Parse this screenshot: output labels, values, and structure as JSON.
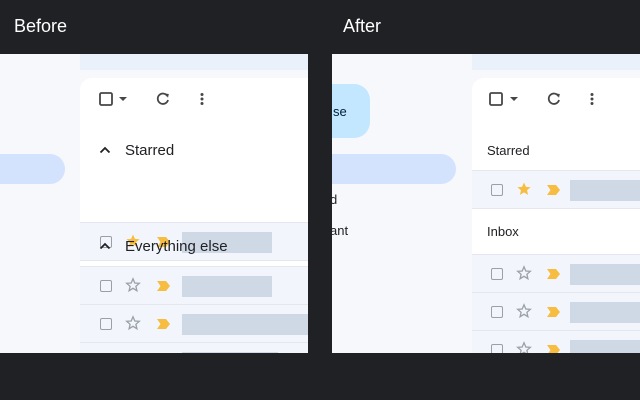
{
  "before": {
    "heading": "Before",
    "sections": [
      {
        "title": "Starred",
        "expand_icon": "chevron-up-icon"
      },
      {
        "title": "Everything else",
        "expand_icon": "chevron-up-icon"
      }
    ],
    "toolbar_icons": [
      "checkbox-icon",
      "caret-down-icon",
      "refresh-icon",
      "more-vert-icon"
    ]
  },
  "after": {
    "heading": "After",
    "compose_fragment": "se",
    "nav_fragments": [
      "d",
      "ant"
    ],
    "sections": [
      {
        "title": "Starred"
      },
      {
        "title": "Inbox"
      }
    ],
    "toolbar_icons": [
      "checkbox-icon",
      "caret-down-icon",
      "refresh-icon",
      "more-vert-icon"
    ]
  },
  "colors": {
    "background": "#202124",
    "panel": "#f6f8fc",
    "row_unread": "#f2f6fc",
    "placeholder_bar": "#cfd9e6",
    "star_filled": "#f6bd41",
    "importance_marker": "#f6bd41",
    "nav_active": "#d3e3fd",
    "compose": "#c2e7ff"
  }
}
